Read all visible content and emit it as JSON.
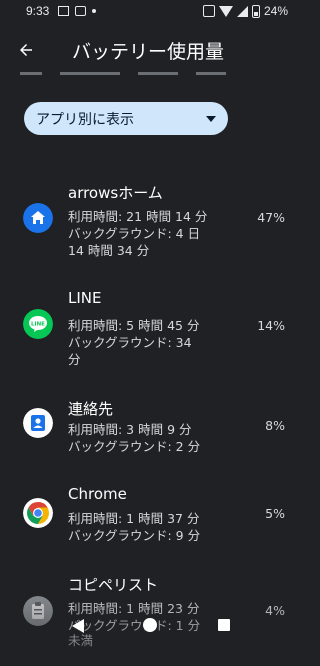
{
  "status_bar": {
    "time": "9:33",
    "battery": "24%"
  },
  "app_bar": {
    "title": "バッテリー使用量"
  },
  "filter": {
    "selected": "アプリ別に表示"
  },
  "apps": [
    {
      "name": "arrowsホーム",
      "usage": "利用時間: 21 時間 14 分",
      "background_1": "バックグラウンド: 4 日",
      "background_2": "14 時間 34 分",
      "percent": "47%",
      "icon": "home-icon",
      "icon_color": "#1a73e8"
    },
    {
      "name": "LINE",
      "usage": "利用時間: 5 時間 45 分",
      "background_1": "バックグラウンド: 34",
      "background_2": "分",
      "percent": "14%",
      "icon": "line-icon",
      "icon_color": "#06c755"
    },
    {
      "name": "連絡先",
      "usage": "利用時間: 3 時間 9 分",
      "background_1": "バックグラウンド: 2 分",
      "background_2": "",
      "percent": "8%",
      "icon": "contacts-icon",
      "icon_color": "#1a73e8"
    },
    {
      "name": "Chrome",
      "usage": "利用時間: 1 時間 37 分",
      "background_1": "バックグラウンド: 9 分",
      "background_2": "",
      "percent": "5%",
      "icon": "chrome-icon",
      "icon_color": "#db4437"
    },
    {
      "name": "コピペリスト",
      "usage": "利用時間: 1 時間 23 分",
      "background_1": "バックグラウンド: 1 分",
      "background_2": "未満",
      "percent": "4%",
      "icon": "clipboard-icon",
      "icon_color": "#8a8f94"
    }
  ]
}
